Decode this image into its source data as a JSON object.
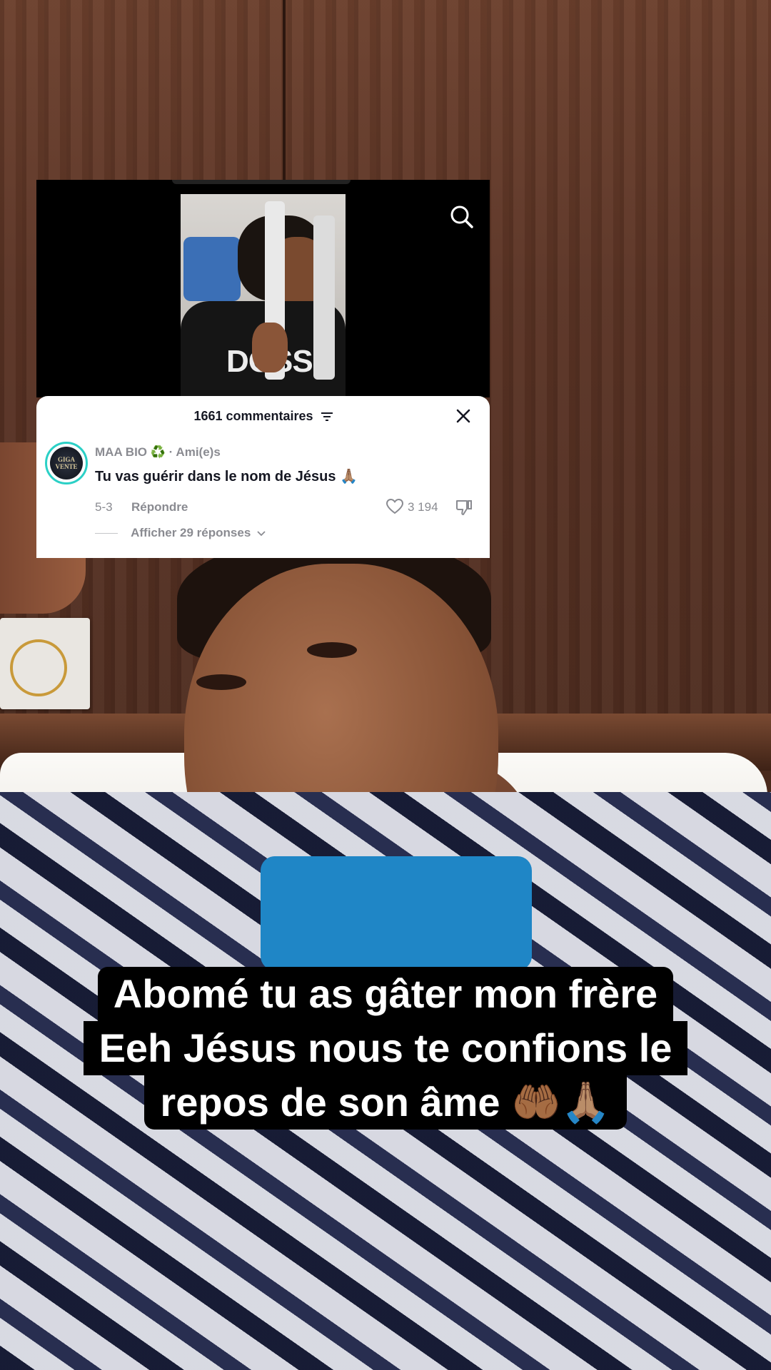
{
  "comments_panel": {
    "header_title": "1661 commentaires",
    "comment": {
      "avatar_text": "GIGA VENTE",
      "username": "MAA BIO",
      "username_badge": "♻️",
      "relationship": "· Ami(e)s",
      "text": "Tu vas guérir dans le nom de Jésus 🙏🏽",
      "date": "5-3",
      "reply_label": "Répondre",
      "like_count": "3 194",
      "view_replies_label": "Afficher 29 réponses"
    }
  },
  "video_thumbnail": {
    "jacket_text": "DOSSE"
  },
  "caption": {
    "line1": "Abomé tu as gâter mon frère",
    "line2": "Eeh Jésus nous te confions le",
    "line3": "repos de son âme 🤲🏾🙏🏽"
  },
  "colors": {
    "avatar_ring": "#2bd0c6",
    "caption_bg": "#000000",
    "panel_bg": "#ffffff",
    "muted_text": "#8a8b91"
  },
  "icons": [
    "search-icon",
    "sort-icon",
    "close-icon",
    "heart-icon",
    "dislike-icon",
    "chevron-down-icon"
  ]
}
